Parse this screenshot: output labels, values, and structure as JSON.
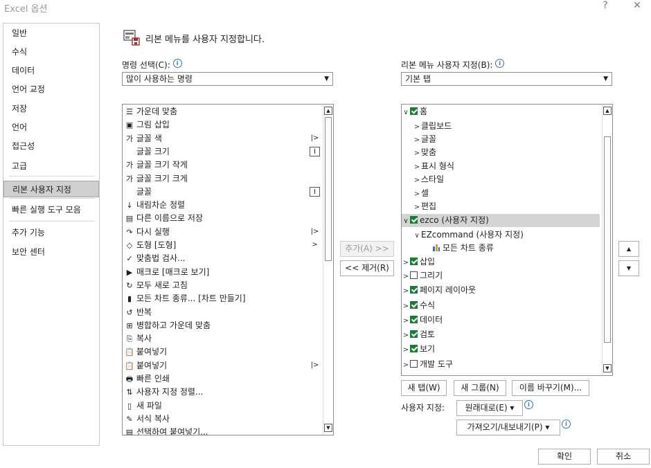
{
  "window": {
    "title": "Excel 옵션",
    "help": "?",
    "close": "✕"
  },
  "nav": {
    "items": [
      {
        "label": "일반"
      },
      {
        "label": "수식"
      },
      {
        "label": "데이터"
      },
      {
        "label": "언어 교정"
      },
      {
        "label": "저장"
      },
      {
        "label": "언어"
      },
      {
        "label": "접근성"
      },
      {
        "label": "고급"
      },
      {
        "label": "리본 사용자 지정"
      },
      {
        "label": "빠른 실행 도구 모음"
      },
      {
        "label": "추가 기능"
      },
      {
        "label": "보안 센터"
      }
    ],
    "selected": "리본 사용자 지정"
  },
  "header": {
    "text": "리본 메뉴를 사용자 지정합니다."
  },
  "commands": {
    "label": "명령 선택(C):",
    "selected": "많이 사용하는 명령",
    "items": [
      {
        "icon": "☰",
        "label": "가운데 맞춤",
        "mark": ""
      },
      {
        "icon": "▣",
        "label": "그림 삽입",
        "mark": ""
      },
      {
        "icon": "가",
        "label": "글꼴 색",
        "mark": "|>"
      },
      {
        "icon": "",
        "label": "글꼴 크기",
        "mark": "I"
      },
      {
        "icon": "가",
        "label": "글꼴 크기 작게",
        "mark": ""
      },
      {
        "icon": "가",
        "label": "글꼴 크기 크게",
        "mark": ""
      },
      {
        "icon": "",
        "label": "글꼴",
        "mark": "I"
      },
      {
        "icon": "↓",
        "label": "내림차순 정렬",
        "mark": ""
      },
      {
        "icon": "▤",
        "label": "다른 이름으로 저장",
        "mark": ""
      },
      {
        "icon": "↷",
        "label": "다시 실행",
        "mark": "|>"
      },
      {
        "icon": "◇",
        "label": "도형 [도형]",
        "mark": ">"
      },
      {
        "icon": "✓",
        "label": "맞춤법 검사...",
        "mark": ""
      },
      {
        "icon": "▶",
        "label": "매크로 [매크로 보기]",
        "mark": ""
      },
      {
        "icon": "↻",
        "label": "모두 새로 고침",
        "mark": ""
      },
      {
        "icon": "▮",
        "label": "모든 차트 종류... [차트 만들기]",
        "mark": ""
      },
      {
        "icon": "↺",
        "label": "반복",
        "mark": ""
      },
      {
        "icon": "⊞",
        "label": "병합하고 가운데 맞춤",
        "mark": ""
      },
      {
        "icon": "⎘",
        "label": "복사",
        "mark": ""
      },
      {
        "icon": "📋",
        "label": "붙여넣기",
        "mark": ""
      },
      {
        "icon": "📋",
        "label": "붙여넣기",
        "mark": "|>"
      },
      {
        "icon": "🖶",
        "label": "빠른 인쇄",
        "mark": ""
      },
      {
        "icon": "⇅",
        "label": "사용자 지정 정렬...",
        "mark": ""
      },
      {
        "icon": "▯",
        "label": "새 파일",
        "mark": ""
      },
      {
        "icon": "✎",
        "label": "서식 복사",
        "mark": ""
      },
      {
        "icon": "▤",
        "label": "선택하여 붙여넣기...",
        "mark": ""
      }
    ]
  },
  "ribbon": {
    "label": "리본 메뉴 사용자 지정(B):",
    "selected": "기본 탭",
    "tree": [
      {
        "chev": "∨",
        "check": true,
        "label": "홈",
        "level": 0
      },
      {
        "chev": ">",
        "check": null,
        "label": "클립보드",
        "level": 2
      },
      {
        "chev": ">",
        "check": null,
        "label": "글꼴",
        "level": 2
      },
      {
        "chev": ">",
        "check": null,
        "label": "맞춤",
        "level": 2
      },
      {
        "chev": ">",
        "check": null,
        "label": "표시 형식",
        "level": 2
      },
      {
        "chev": ">",
        "check": null,
        "label": "스타일",
        "level": 2
      },
      {
        "chev": ">",
        "check": null,
        "label": "셀",
        "level": 2
      },
      {
        "chev": ">",
        "check": null,
        "label": "편집",
        "level": 2
      },
      {
        "chev": "∨",
        "check": true,
        "label": "ezco (사용자 지정)",
        "level": 0
      },
      {
        "chev": "∨",
        "check": null,
        "label": "EZcommand (사용자 지정)",
        "level": 2
      },
      {
        "chev": "",
        "check": null,
        "label": "모든 차트 종류",
        "level": 4
      },
      {
        "chev": ">",
        "check": true,
        "label": "삽입",
        "level": 0
      },
      {
        "chev": ">",
        "check": false,
        "label": "그리기",
        "level": 0
      },
      {
        "chev": ">",
        "check": true,
        "label": "페이지 레이아웃",
        "level": 0
      },
      {
        "chev": ">",
        "check": true,
        "label": "수식",
        "level": 0
      },
      {
        "chev": ">",
        "check": true,
        "label": "데이터",
        "level": 0
      },
      {
        "chev": ">",
        "check": true,
        "label": "검토",
        "level": 0
      },
      {
        "chev": ">",
        "check": true,
        "label": "보기",
        "level": 0
      },
      {
        "chev": ">",
        "check": false,
        "label": "개발 도구",
        "level": 0
      }
    ],
    "highlighted": "ezco (사용자 지정)"
  },
  "mid": {
    "add": "추가(A) >>",
    "remove": "<< 제거(R)"
  },
  "bottom": {
    "new_tab": "새 탭(W)",
    "new_group": "새 그룹(N)",
    "rename": "이름 바꾸기(M)...",
    "custom_label": "사용자 지정:",
    "reset": "원래대로(E) ▾",
    "import_export": "가져오기/내보내기(P) ▾"
  },
  "footer": {
    "ok": "확인",
    "cancel": "취소"
  },
  "colors": {
    "check": "#1f7a3a",
    "accent": "#2a74c8"
  }
}
